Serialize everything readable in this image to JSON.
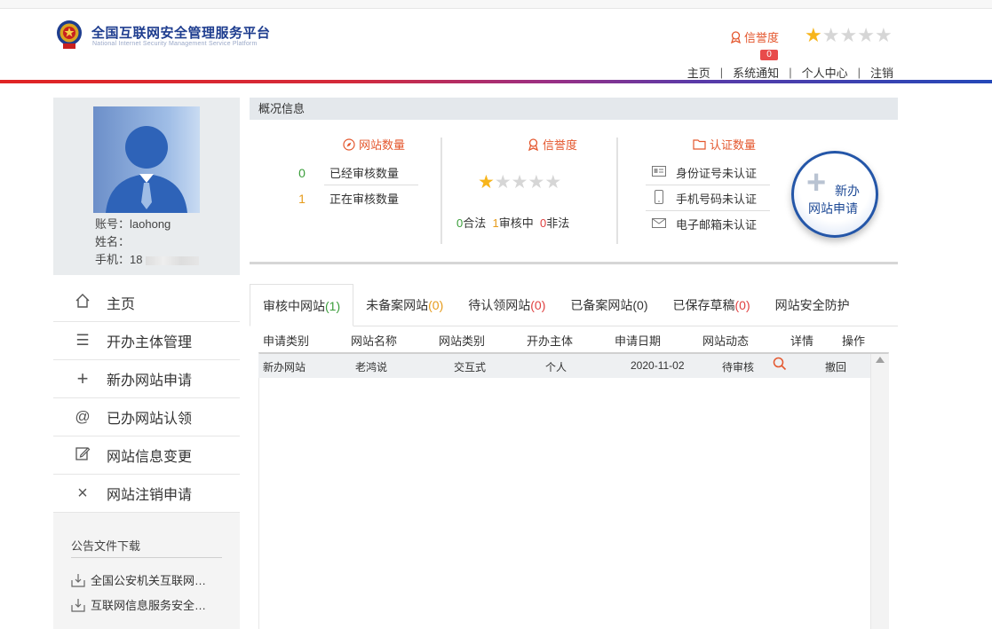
{
  "header": {
    "title": "全国互联网安全管理服务平台",
    "subtitle": "National Internet Security Management Service Platform",
    "credit_label": "信誉度",
    "credit_badge": "0",
    "stars_filled": 1,
    "stars_total": 5,
    "nav": [
      "主页",
      "系统通知",
      "个人中心",
      "注销"
    ]
  },
  "profile": {
    "account_label": "账号：",
    "account": "laohong",
    "name_label": "姓名：",
    "phone_label": "手机：",
    "phone_visible": "18"
  },
  "menu": [
    {
      "label": "主页",
      "icon": "home-icon"
    },
    {
      "label": "开办主体管理",
      "icon": "list-icon"
    },
    {
      "label": "新办网站申请",
      "icon": "plus-icon"
    },
    {
      "label": "已办网站认领",
      "icon": "at-icon"
    },
    {
      "label": "网站信息变更",
      "icon": "edit-icon"
    },
    {
      "label": "网站注销申请",
      "icon": "close-icon"
    }
  ],
  "notice": {
    "title": "公告文件下载",
    "items": [
      "全国公安机关互联网…",
      "互联网信息服务安全…"
    ]
  },
  "overview": {
    "header": "概况信息",
    "sites": {
      "title": "网站数量",
      "approved_count": "0",
      "approved_label": "已经审核数量",
      "pending_count": "1",
      "pending_label": "正在审核数量"
    },
    "credit": {
      "title": "信誉度",
      "stars_filled": 1,
      "legal_count": "0",
      "legal_label": "合法",
      "review_count": "1",
      "review_label": "审核中",
      "illegal_count": "0",
      "illegal_label": "非法"
    },
    "cert": {
      "title": "认证数量",
      "id": "身份证号未认证",
      "phone": "手机号码未认证",
      "email": "电子邮箱未认证"
    },
    "new_button": {
      "line1": "新办",
      "line2": "网站申请"
    }
  },
  "tabs": [
    {
      "label": "审核中网站",
      "count": "(1)",
      "color": "g"
    },
    {
      "label": "未备案网站",
      "count": "(0)",
      "color": "o"
    },
    {
      "label": "待认领网站",
      "count": "(0)",
      "color": "r"
    },
    {
      "label": "已备案网站",
      "count": "(0)",
      "color": ""
    },
    {
      "label": "已保存草稿",
      "count": "(0)",
      "color": "r"
    },
    {
      "label": "网站安全防护",
      "count": "",
      "color": ""
    }
  ],
  "table": {
    "columns": [
      "申请类别",
      "网站名称",
      "网站类别",
      "开办主体",
      "申请日期",
      "网站动态",
      "详情",
      "操作"
    ],
    "rows": [
      {
        "type": "新办网站",
        "name": "老鸿说",
        "category": "交互式",
        "owner": "个人",
        "date": "2020-11-02",
        "status": "待审核",
        "action": "撤回"
      }
    ]
  }
}
